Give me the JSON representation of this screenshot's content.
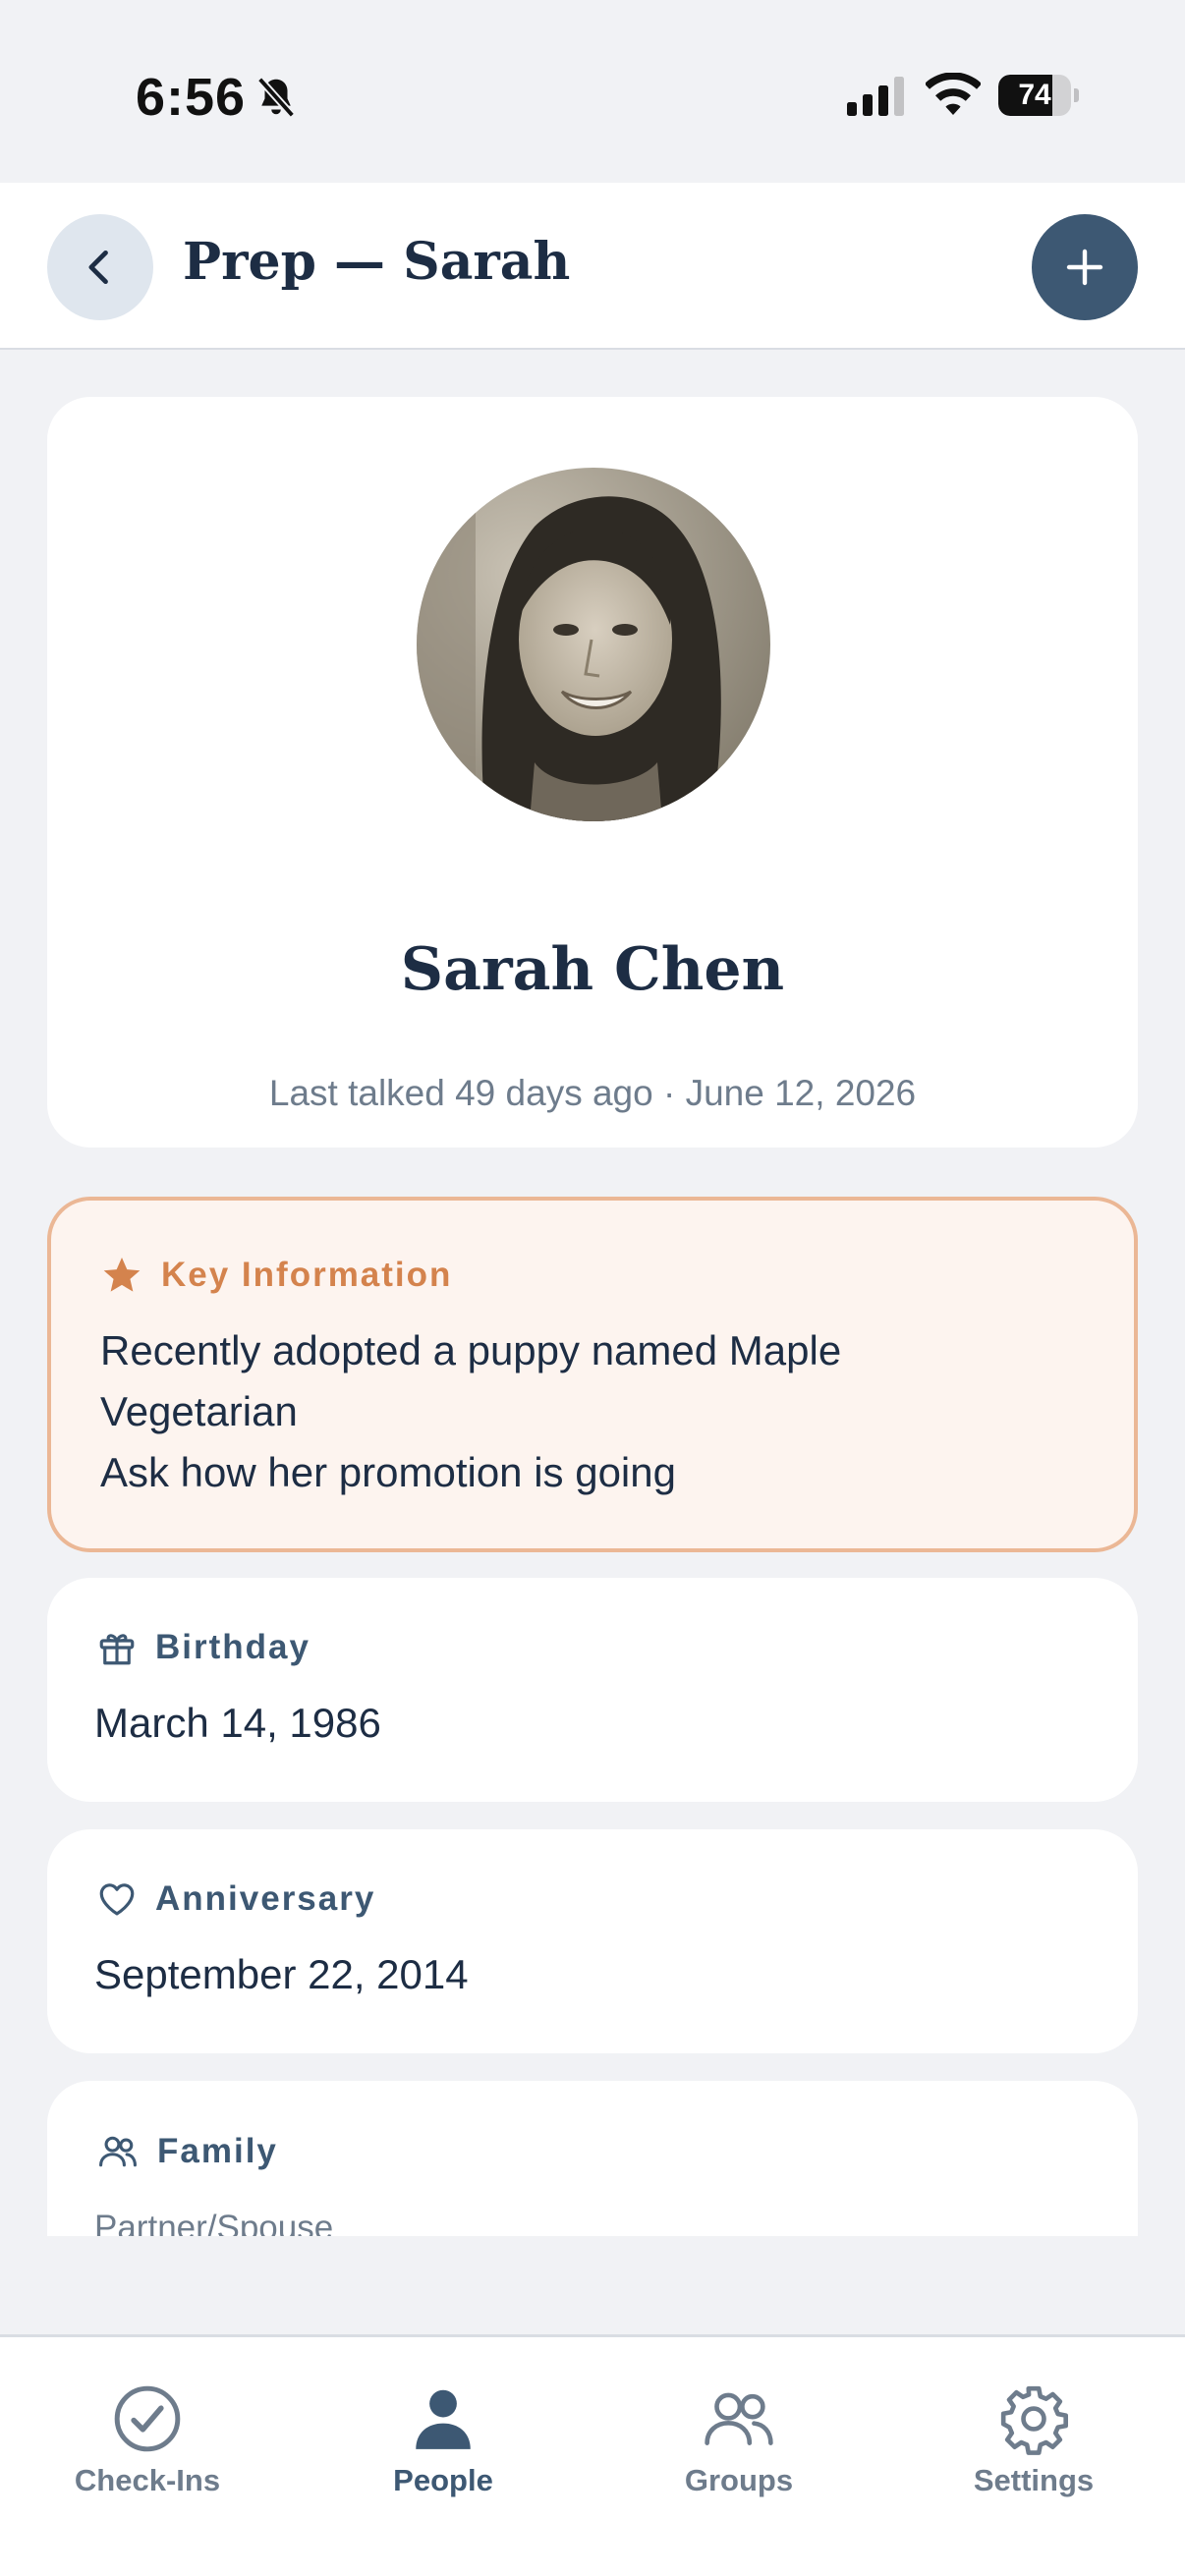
{
  "status_bar": {
    "time": "6:56",
    "battery": "74",
    "battery_level": 0.74
  },
  "header": {
    "title": "Prep — Sarah",
    "back_icon": "chevron-left-icon",
    "add_icon": "plus-icon"
  },
  "profile": {
    "name": "Sarah Chen",
    "last_talked": "Last talked 49 days ago · June 12, 2026"
  },
  "key_information": {
    "title": "Key Information",
    "icon": "star-icon",
    "lines": [
      "Recently adopted a puppy named Maple",
      "Vegetarian",
      "Ask how her promotion is going"
    ]
  },
  "birthday": {
    "title": "Birthday",
    "icon": "gift-icon",
    "value": "March 14, 1986"
  },
  "anniversary": {
    "title": "Anniversary",
    "icon": "heart-icon",
    "value": "September 22, 2014"
  },
  "family": {
    "title": "Family",
    "icon": "people-icon",
    "subtitle": "Partner/Spouse"
  },
  "tab_bar": {
    "items": [
      {
        "label": "Check-Ins",
        "icon": "check-circle-icon",
        "active": false
      },
      {
        "label": "People",
        "icon": "person-icon",
        "active": true
      },
      {
        "label": "Groups",
        "icon": "groups-icon",
        "active": false
      },
      {
        "label": "Settings",
        "icon": "gear-icon",
        "active": false
      }
    ]
  },
  "colors": {
    "accent": "#3d5873",
    "key_accent": "#d4834d",
    "key_background": "#fdf4ef",
    "background": "#f1f2f5"
  }
}
